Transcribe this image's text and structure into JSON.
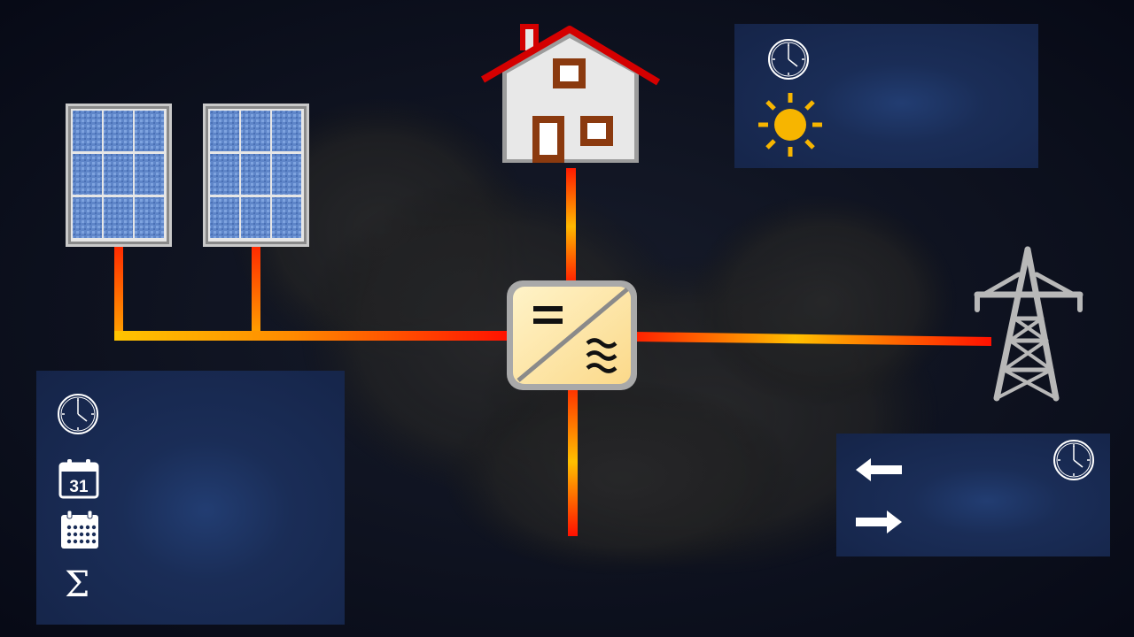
{
  "colors": {
    "background": "#0b1020",
    "panel": "#1a2d57",
    "line_red": "#ff1a00",
    "line_orange": "#ff7a00",
    "line_yellow": "#ffcc00",
    "sun": "#f7b500",
    "roof": "#d40000",
    "house_wall": "#e6e6e6",
    "house_trim": "#8b3a0f",
    "pylon": "#b8b8b8",
    "inverter_face": "#fde3a0"
  },
  "icons": {
    "solar_panel": "solar-panel-icon",
    "house": "house-icon",
    "inverter": "inverter-icon",
    "pylon": "power-pylon-icon",
    "clock": "clock-icon",
    "sun": "sun-icon",
    "calendar_day": "calendar-day-icon",
    "calendar_month": "calendar-month-icon",
    "sigma": "sigma-icon",
    "arrow_left": "arrow-left-icon",
    "arrow_right": "arrow-right-icon"
  },
  "labels": {
    "calendar_day": "31",
    "inverter_dc": "=",
    "inverter_ac": "≋",
    "sigma": "Σ"
  }
}
